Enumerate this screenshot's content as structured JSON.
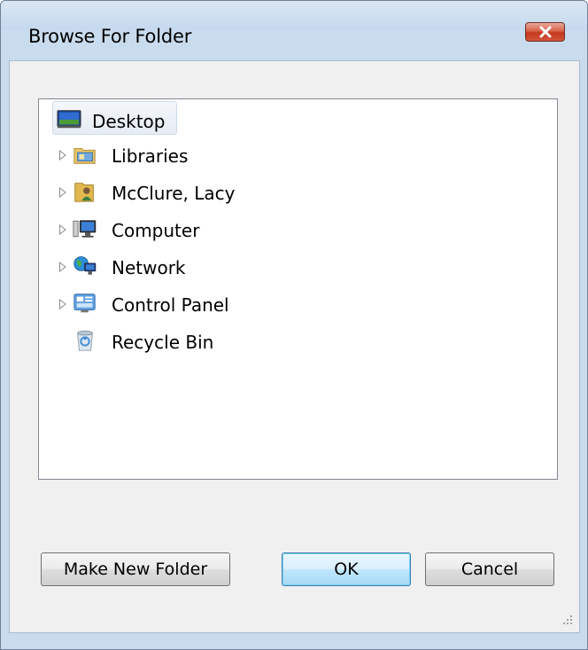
{
  "window": {
    "title": "Browse For Folder",
    "close_icon": "close-icon"
  },
  "tree": {
    "items": [
      {
        "label": "Desktop",
        "icon": "desktop-icon",
        "expandable": false,
        "selected": true
      },
      {
        "label": "Libraries",
        "icon": "libraries-icon",
        "expandable": true,
        "selected": false
      },
      {
        "label": "McClure, Lacy",
        "icon": "user-folder-icon",
        "expandable": true,
        "selected": false
      },
      {
        "label": "Computer",
        "icon": "computer-icon",
        "expandable": true,
        "selected": false
      },
      {
        "label": "Network",
        "icon": "network-icon",
        "expandable": true,
        "selected": false
      },
      {
        "label": "Control Panel",
        "icon": "control-panel-icon",
        "expandable": true,
        "selected": false
      },
      {
        "label": "Recycle Bin",
        "icon": "recycle-bin-icon",
        "expandable": false,
        "selected": false
      }
    ]
  },
  "buttons": {
    "make_new_folder": "Make New Folder",
    "ok": "OK",
    "cancel": "Cancel"
  },
  "colors": {
    "title_bar": "#c9dcee",
    "close_button": "#c2381d",
    "default_button_border": "#3c7fb1"
  }
}
